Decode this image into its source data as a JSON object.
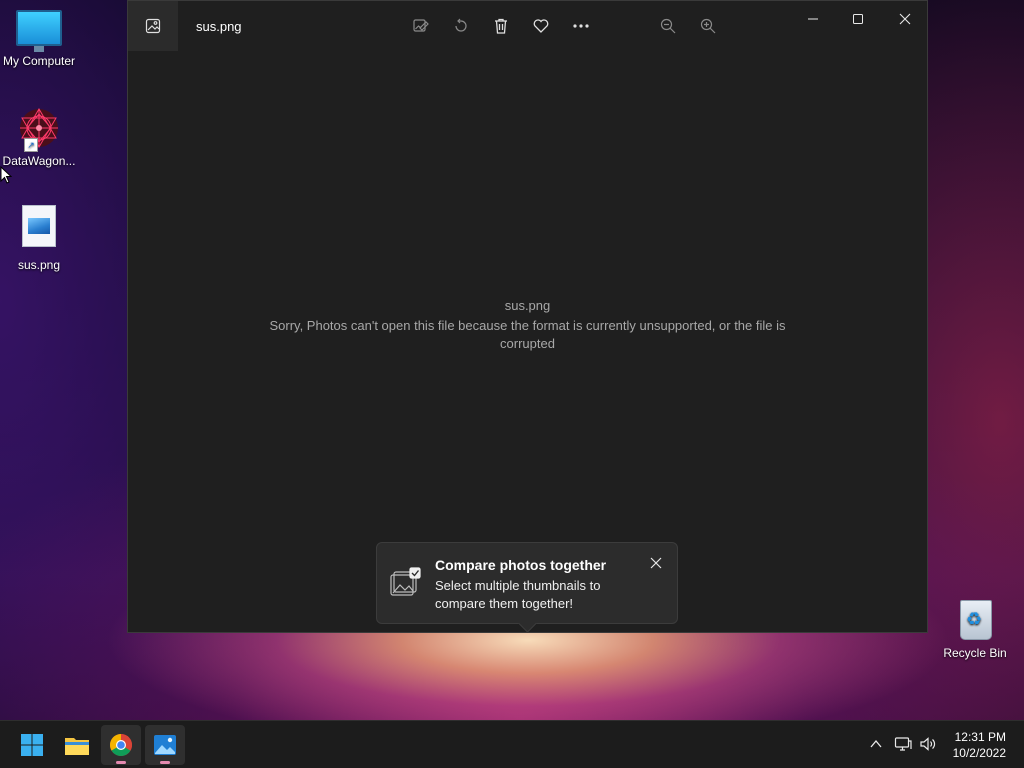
{
  "desktop": {
    "icons": [
      {
        "label": "My Computer",
        "icon": "monitor-icon"
      },
      {
        "label": "DataWagon...",
        "icon": "datawagon-app-icon"
      },
      {
        "label": "sus.png",
        "icon": "image-file-icon"
      },
      {
        "label": "Recycle Bin",
        "icon": "recycle-bin-icon"
      }
    ]
  },
  "photos_window": {
    "title": "sus.png",
    "toolbar": [
      "edit-image-icon",
      "rotate-icon",
      "delete-icon",
      "favorite-heart-icon",
      "more-options-icon",
      "zoom-out-icon",
      "zoom-in-icon"
    ],
    "window_controls": [
      "minimize-icon",
      "maximize-icon",
      "close-icon"
    ],
    "file_name": "sus.png",
    "error_message": "Sorry, Photos can't open this file because the format is currently unsupported, or the file is corrupted"
  },
  "toast": {
    "title": "Compare photos together",
    "body": "Select multiple thumbnails to compare them together!",
    "icon": "compare-photos-icon"
  },
  "taskbar": {
    "apps": [
      "start-windows-icon",
      "file-explorer-icon",
      "chrome-icon",
      "photos-icon"
    ],
    "tray": [
      "chevron-up-icon",
      "network-icon",
      "volume-icon"
    ],
    "time": "12:31 PM",
    "date": "10/2/2022"
  },
  "colors": {
    "accent_pink": "#e48ab0",
    "window_bg": "#1f1f1f",
    "taskbar_bg": "#1c1c1c"
  }
}
